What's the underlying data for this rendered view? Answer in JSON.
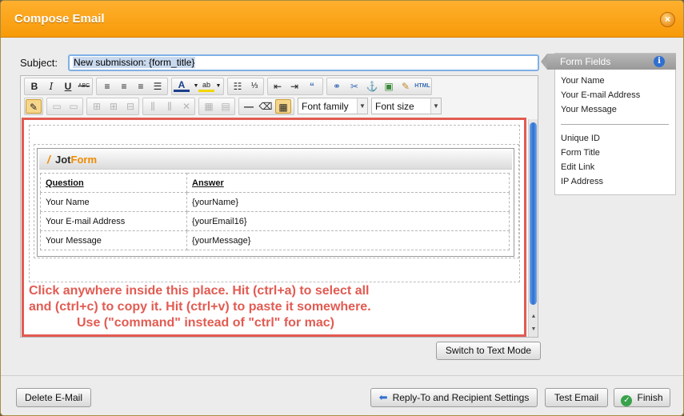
{
  "dialog": {
    "title": "Compose Email",
    "close_glyph": "×"
  },
  "subject": {
    "label": "Subject:",
    "value": "New submission: {form_title}"
  },
  "toolbar": {
    "bold": "B",
    "italic": "I",
    "underline": "U",
    "strikethrough": "ABC",
    "font_family": "Font family",
    "font_size": "Font size",
    "html": "HTML"
  },
  "email_body": {
    "logo_jot": "Jot",
    "logo_form": "Form",
    "headers": [
      "Question",
      "Answer"
    ],
    "rows": [
      [
        "Your Name",
        "{yourName}"
      ],
      [
        "Your E-mail Address",
        "{yourEmail16}"
      ],
      [
        "Your Message",
        "{yourMessage}"
      ]
    ],
    "instructions": [
      "Click anywhere inside this place. Hit (ctrl+a) to select all",
      "and (ctrl+c) to copy it. Hit (ctrl+v) to paste it somewhere.",
      "Use (\"command\" instead of \"ctrl\" for mac)"
    ]
  },
  "switch_mode_label": "Switch to Text Mode",
  "form_fields": {
    "title": "Form Fields",
    "items": [
      "Your Name",
      "Your E-mail Address",
      "Your Message"
    ],
    "system_items": [
      "Unique ID",
      "Form Title",
      "Edit Link",
      "IP Address"
    ]
  },
  "footer": {
    "delete": "Delete E-Mail",
    "reply_to": "Reply-To and Recipient Settings",
    "test": "Test Email",
    "finish": "Finish"
  },
  "colors": {
    "title_bar": "#f79a08",
    "highlight_border": "#e25b52",
    "accent": "#2f6fd0"
  }
}
